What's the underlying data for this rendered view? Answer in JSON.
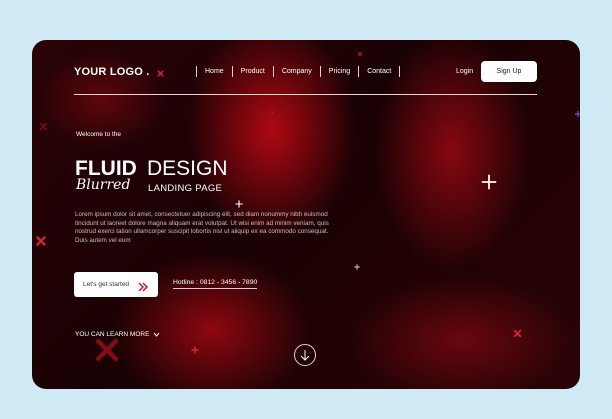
{
  "brand": {
    "logo": "YOUR LOGO ."
  },
  "nav": {
    "items": [
      "Home",
      "Product",
      "Company",
      "Pricing",
      "Contact"
    ]
  },
  "auth": {
    "login": "Login",
    "signup": "Sign Up"
  },
  "hero": {
    "welcome": "Welcome to the",
    "title_bold": "FLUID",
    "title_light": "DESIGN",
    "script": "Blurred",
    "subtitle": "LANDING PAGE",
    "body": "Lorem ipsum dolor sit amet, consectetuer adipiscing elit, sed diam nonummy nibh euismod tincidunt ut laoreet dolore magna aliquam erat volutpat. Ut wisi enim ad minim veniam, quis nostrud exerci tation ullamcorper suscipit lobortis nisl ut aliquip ex ea commodo consequat. Duis autem vel eum"
  },
  "cta": {
    "label": "Let's get started"
  },
  "hotline": {
    "text": "Hotline : 0812 - 3456 - 7890"
  },
  "learn_more": {
    "label": "YOU CAN LEARN MORE"
  },
  "icons": {
    "cta": "double-chevron-right-icon",
    "learn_more": "chevron-down-icon",
    "scroll": "arrow-down-icon",
    "decoration": "cross-sparkle-icon"
  },
  "colors": {
    "background": "#cfe9f5",
    "card_dark": "#1a0204",
    "accent_red": "#c8101e",
    "white": "#ffffff"
  }
}
